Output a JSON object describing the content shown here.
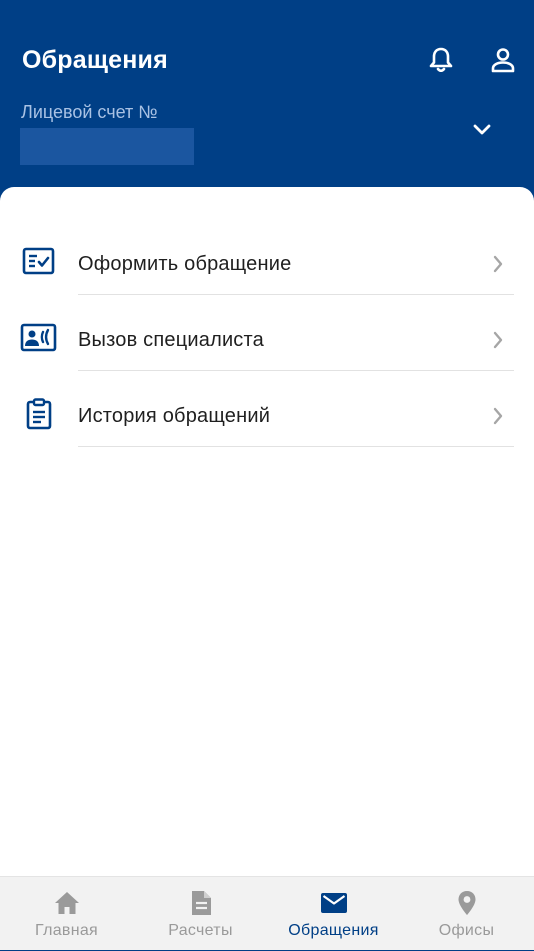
{
  "header": {
    "title": "Обращения",
    "account_label": "Лицевой счет №",
    "account_number": "",
    "icons": [
      "bell-icon",
      "user-icon",
      "chevron-down-icon"
    ]
  },
  "menu": {
    "items": [
      {
        "label": "Оформить обращение",
        "icon": "checklist-form-icon"
      },
      {
        "label": "Вызов специалиста",
        "icon": "contact-card-icon"
      },
      {
        "label": "История обращений",
        "icon": "clipboard-icon"
      }
    ]
  },
  "tabbar": {
    "tabs": [
      {
        "label": "Главная",
        "icon": "home-icon",
        "active": false
      },
      {
        "label": "Расчеты",
        "icon": "document-icon",
        "active": false
      },
      {
        "label": "Обращения",
        "icon": "envelope-icon",
        "active": true
      },
      {
        "label": "Офисы",
        "icon": "map-pin-icon",
        "active": false
      }
    ]
  },
  "colors": {
    "brand": "#003f86",
    "inactive": "#9a9a9a",
    "masked_field": "#1b56a0"
  }
}
